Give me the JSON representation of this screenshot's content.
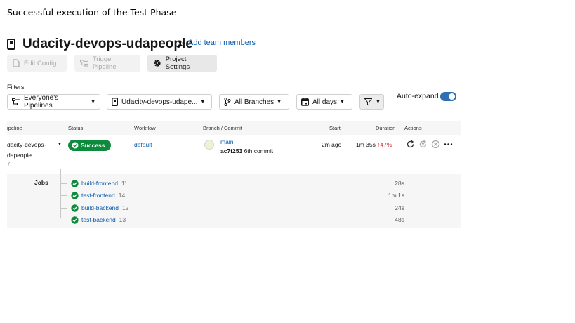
{
  "caption": "Successful execution of the Test Phase",
  "project": {
    "title": "Udacity-devops-udapeople",
    "add_team_label": "Add team members"
  },
  "toolbar": {
    "edit_config_label": "Edit Config",
    "trigger_pipeline_label": "Trigger Pipeline",
    "project_settings_label": "Project Settings"
  },
  "filters": {
    "label": "Filters",
    "pipelines": "Everyone's Pipelines",
    "project": "Udacity-devops-udape...",
    "branches": "All Branches",
    "days": "All days",
    "auto_expand_label": "Auto-expand",
    "auto_expand_on": true
  },
  "table": {
    "headers": {
      "pipeline": "ipeline",
      "status": "Status",
      "workflow": "Workflow",
      "branch_commit": "Branch / Commit",
      "start": "Start",
      "duration": "Duration",
      "actions": "Actions"
    },
    "row": {
      "pipeline_line1": "dacity-devops-",
      "pipeline_line2": "dapeople",
      "pipeline_num": "7",
      "status": "Success",
      "workflow": "default",
      "branch": "main",
      "commit_sha": "ac7f253",
      "commit_msg": "6th commit",
      "start": "2m ago",
      "duration": "1m 35s",
      "duration_change": "47%",
      "status_color": "#0e8a3c"
    }
  },
  "jobs": {
    "label": "Jobs",
    "items": [
      {
        "name": "build-frontend",
        "num": "11",
        "duration": "28s"
      },
      {
        "name": "test-frontend",
        "num": "14",
        "duration": "1m 1s"
      },
      {
        "name": "build-backend",
        "num": "12",
        "duration": "24s"
      },
      {
        "name": "test-backend",
        "num": "13",
        "duration": "48s"
      }
    ]
  },
  "icons": {
    "bookmark": "bookmark-icon",
    "team": "add-team-icon",
    "edit_config": "file-icon",
    "trigger": "pipeline-icon",
    "settings": "gear-icon",
    "pipelines_filter": "pipelines-icon",
    "project_filter": "bookmark-icon",
    "branch": "branch-icon",
    "calendar": "calendar-icon",
    "funnel": "filter-icon",
    "rerun": "rerun-icon",
    "rerun_failed": "rerun-failed-icon",
    "cancel": "cancel-icon",
    "more": "more-icon",
    "check": "check-circle-icon"
  },
  "colors": {
    "link": "#0b5cad",
    "success": "#0e8a3c",
    "toggle": "#2f6fb2",
    "increase": "#c8252c"
  }
}
